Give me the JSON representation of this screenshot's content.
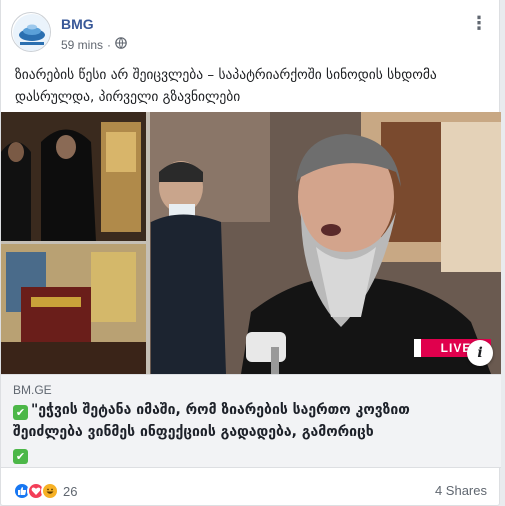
{
  "post": {
    "page_name": "BMG",
    "time": "59 mins",
    "privacy_icon": "globe-icon",
    "text": "ზიარების წესი არ შეიცვლება – საპატრიარქოში სინოდის სხდომა დასრულდა, პირველი გზავნილები"
  },
  "media": {
    "live_label": "LIVE",
    "info_label": "i"
  },
  "link": {
    "domain": "BM.GE",
    "title": "\"ეჭვის შეტანა იმაში, რომ ზიარების საერთო კოვზით შეიძლება ვინმეს ინფექციის გადადება, გამორიცხ"
  },
  "footer": {
    "reaction_count": "26",
    "shares": "4 Shares",
    "reaction_icons": [
      "like-icon",
      "love-icon",
      "haha-icon"
    ]
  },
  "colors": {
    "page_name": "#385898",
    "live_bg": "#e0004d",
    "check_green": "#4cb748"
  }
}
